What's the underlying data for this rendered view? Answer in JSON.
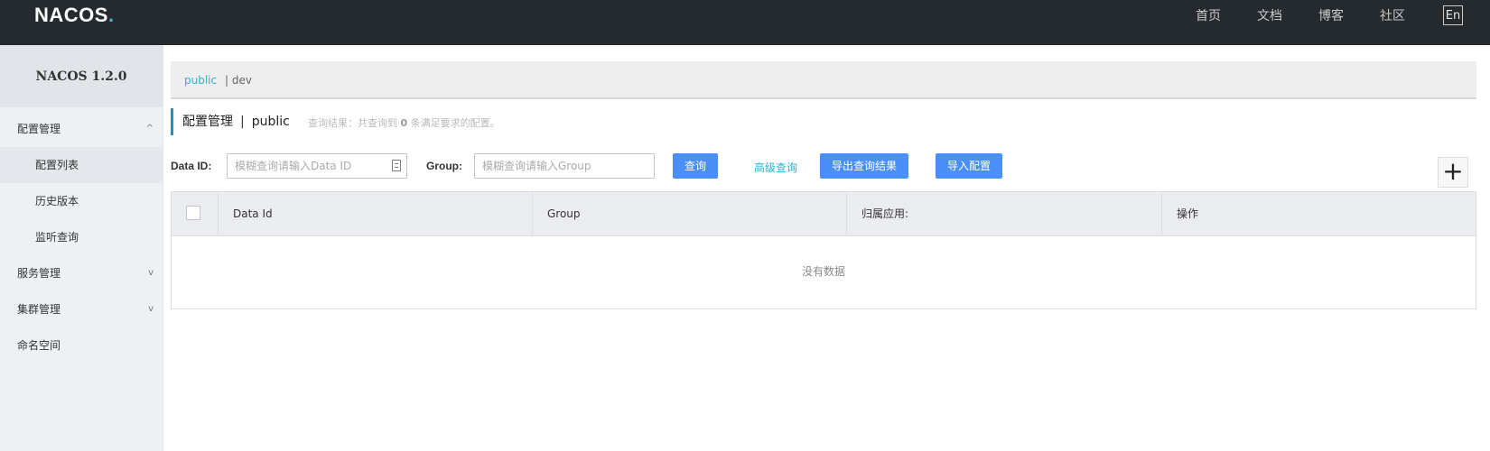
{
  "header": {
    "logo_main": "NACOS",
    "logo_dot": ".",
    "nav": [
      "首页",
      "文档",
      "博客",
      "社区"
    ],
    "lang": "En"
  },
  "sidebar": {
    "version": "NACOS 1.2.0",
    "items": [
      {
        "label": "配置管理",
        "chevron": "^"
      },
      {
        "label": "配置列表"
      },
      {
        "label": "历史版本"
      },
      {
        "label": "监听查询"
      },
      {
        "label": "服务管理",
        "chevron": "v"
      },
      {
        "label": "集群管理",
        "chevron": "v"
      },
      {
        "label": "命名空间"
      }
    ]
  },
  "namespaces": {
    "current": "public",
    "separator": "| dev"
  },
  "page": {
    "title": "配置管理",
    "separator": "|",
    "namespace": "public",
    "summary_prefix": "查询结果：共查询到",
    "summary_count": "0",
    "summary_suffix": "条满足要求的配置。"
  },
  "search": {
    "dataid_label": "Data ID:",
    "dataid_placeholder": "模糊查询请输入Data ID",
    "group_label": "Group:",
    "group_placeholder": "模糊查询请输入Group",
    "query_button": "查询",
    "advanced_link": "高级查询",
    "export_button": "导出查询结果",
    "import_button": "导入配置",
    "add_button": "+"
  },
  "table": {
    "columns": [
      "Data Id",
      "Group",
      "归属应用:",
      "操作"
    ],
    "empty_text": "没有数据"
  }
}
